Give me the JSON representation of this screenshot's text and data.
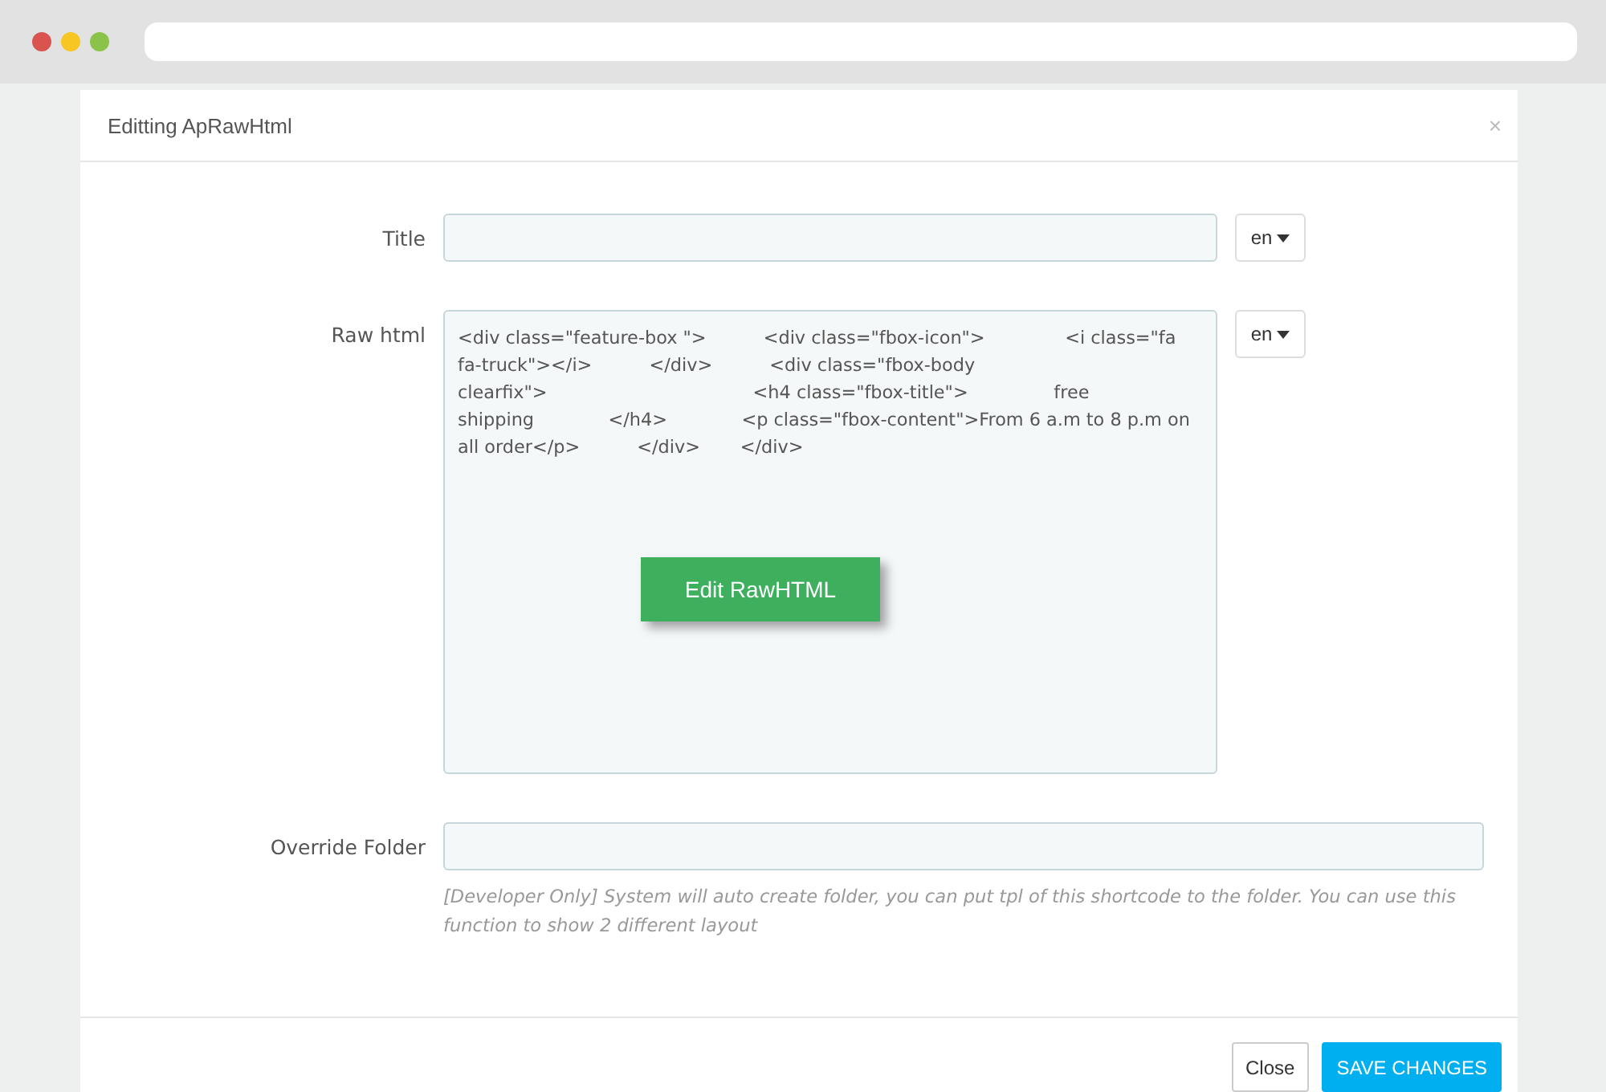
{
  "modal": {
    "title": "Editting ApRawHtml",
    "close": "×"
  },
  "fields": [
    {
      "kind": "input",
      "label": "Title",
      "lang": "en"
    },
    {
      "kind": "code",
      "label": "Raw html",
      "lang": "en",
      "lines": [
        "<div class=\"feature-box \">          <div class=\"fbox-icon\">              <i class=\"fa",
        "fa-truck\"></i>          </div>          <div class=\"fbox-body",
        "clearfix\">                                    <h4 class=\"fbox-title\">               free",
        "shipping             </h4>             <p class=\"fbox-content\">From 6 a.m to 8 p.m on",
        "all order</p>          </div>       </div>"
      ],
      "overlay_button": "Edit RawHTML"
    },
    {
      "kind": "input",
      "label": "Override Folder",
      "help": "[Developer Only] System will auto create folder, you can put tpl of this shortcode to the folder. You can use this function to show 2 different layout"
    }
  ],
  "buttons": [
    {
      "label": "Close",
      "kind": "default"
    },
    {
      "label": "SAVE CHANGES",
      "kind": "primary"
    }
  ]
}
